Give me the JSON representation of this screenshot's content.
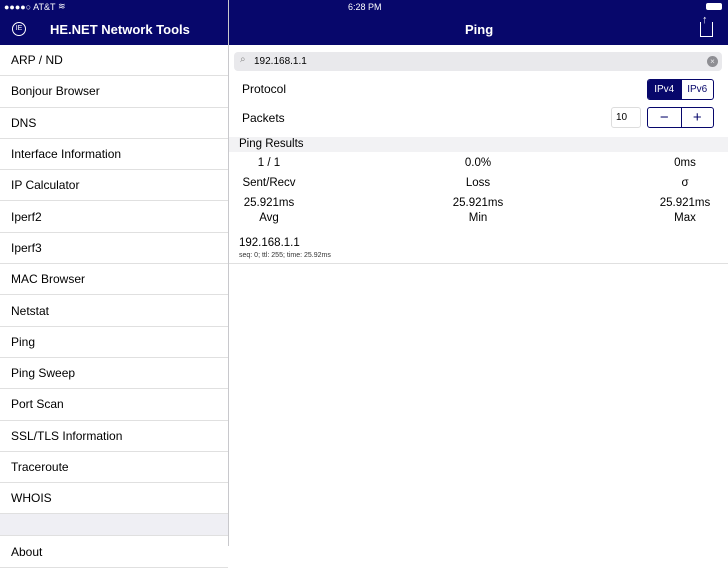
{
  "status_bar": {
    "carrier": "●●●●○ AT&T",
    "time": "6:28 PM"
  },
  "sidebar": {
    "title": "HE.NET Network Tools",
    "items": [
      {
        "label": "ARP / ND"
      },
      {
        "label": "Bonjour Browser"
      },
      {
        "label": "DNS"
      },
      {
        "label": "Interface Information"
      },
      {
        "label": "IP Calculator"
      },
      {
        "label": "Iperf2"
      },
      {
        "label": "Iperf3"
      },
      {
        "label": "MAC Browser"
      },
      {
        "label": "Netstat"
      },
      {
        "label": "Ping"
      },
      {
        "label": "Ping Sweep"
      },
      {
        "label": "Port Scan"
      },
      {
        "label": "SSL/TLS Information"
      },
      {
        "label": "Traceroute"
      },
      {
        "label": "WHOIS"
      }
    ],
    "about": "About"
  },
  "main": {
    "title": "Ping",
    "search_value": "192.168.1.1",
    "protocol": {
      "label": "Protocol",
      "options": [
        "IPv4",
        "IPv6"
      ],
      "selected": "IPv4"
    },
    "packets": {
      "label": "Packets",
      "value": "10",
      "minus": "−",
      "plus": "+"
    },
    "results": {
      "header": "Ping Results",
      "stats": [
        {
          "value": "1 / 1",
          "label": "Sent/Recv"
        },
        {
          "value": "0.0%",
          "label": "Loss"
        },
        {
          "value": "0ms",
          "label": "σ"
        },
        {
          "value": "25.921ms",
          "label": "Avg"
        },
        {
          "value": "25.921ms",
          "label": "Min"
        },
        {
          "value": "25.921ms",
          "label": "Max"
        }
      ],
      "entries": [
        {
          "host": "192.168.1.1",
          "detail": "seq: 0; ttl: 255; time: 25.92ms"
        }
      ]
    }
  },
  "colors": {
    "nav": "#07076b"
  }
}
